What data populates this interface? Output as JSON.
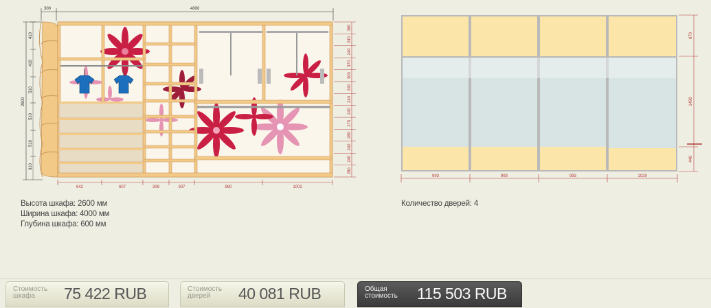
{
  "wardrobe": {
    "top_dims": [
      "300",
      "4000"
    ],
    "height_dim": "2600",
    "left_dims": [
      "410",
      "410",
      "510",
      "510",
      "510",
      "310"
    ],
    "bottom_dims": [
      "642",
      "607",
      "308",
      "307",
      "980",
      "1002"
    ],
    "right_dims": [
      "380",
      "240",
      "240",
      "370",
      "300",
      "240",
      "240",
      "240",
      "270",
      "280",
      "240",
      "240",
      "280"
    ]
  },
  "doors_view": {
    "bottom_dims": [
      "993",
      "993",
      "993",
      "1029"
    ],
    "right_dims": [
      "670",
      "1490",
      "440"
    ]
  },
  "info": {
    "height": "Высота шкафа: 2600 мм",
    "width": "Ширина шкафа: 4000 мм",
    "depth": "Глубина шкафа: 600 мм",
    "doors_count": "Количество дверей: 4"
  },
  "prices": {
    "wardrobe_label_1": "Стоимость",
    "wardrobe_label_2": "шкафа",
    "wardrobe_value": "75 422  RUB",
    "doors_label_1": "Стоимость",
    "doors_label_2": "дверей",
    "doors_value": "40 081  RUB",
    "total_label_1": "Общая",
    "total_label_2": "стоимость",
    "total_value": "115 503  RUB"
  },
  "colors": {
    "wood": "#f2c987",
    "wood_edge": "#c8965a",
    "mirror": "#d6e2e2",
    "door_panel": "#fbe5a8",
    "frame": "#b9b9b9",
    "dim_red": "#b03a3a"
  }
}
